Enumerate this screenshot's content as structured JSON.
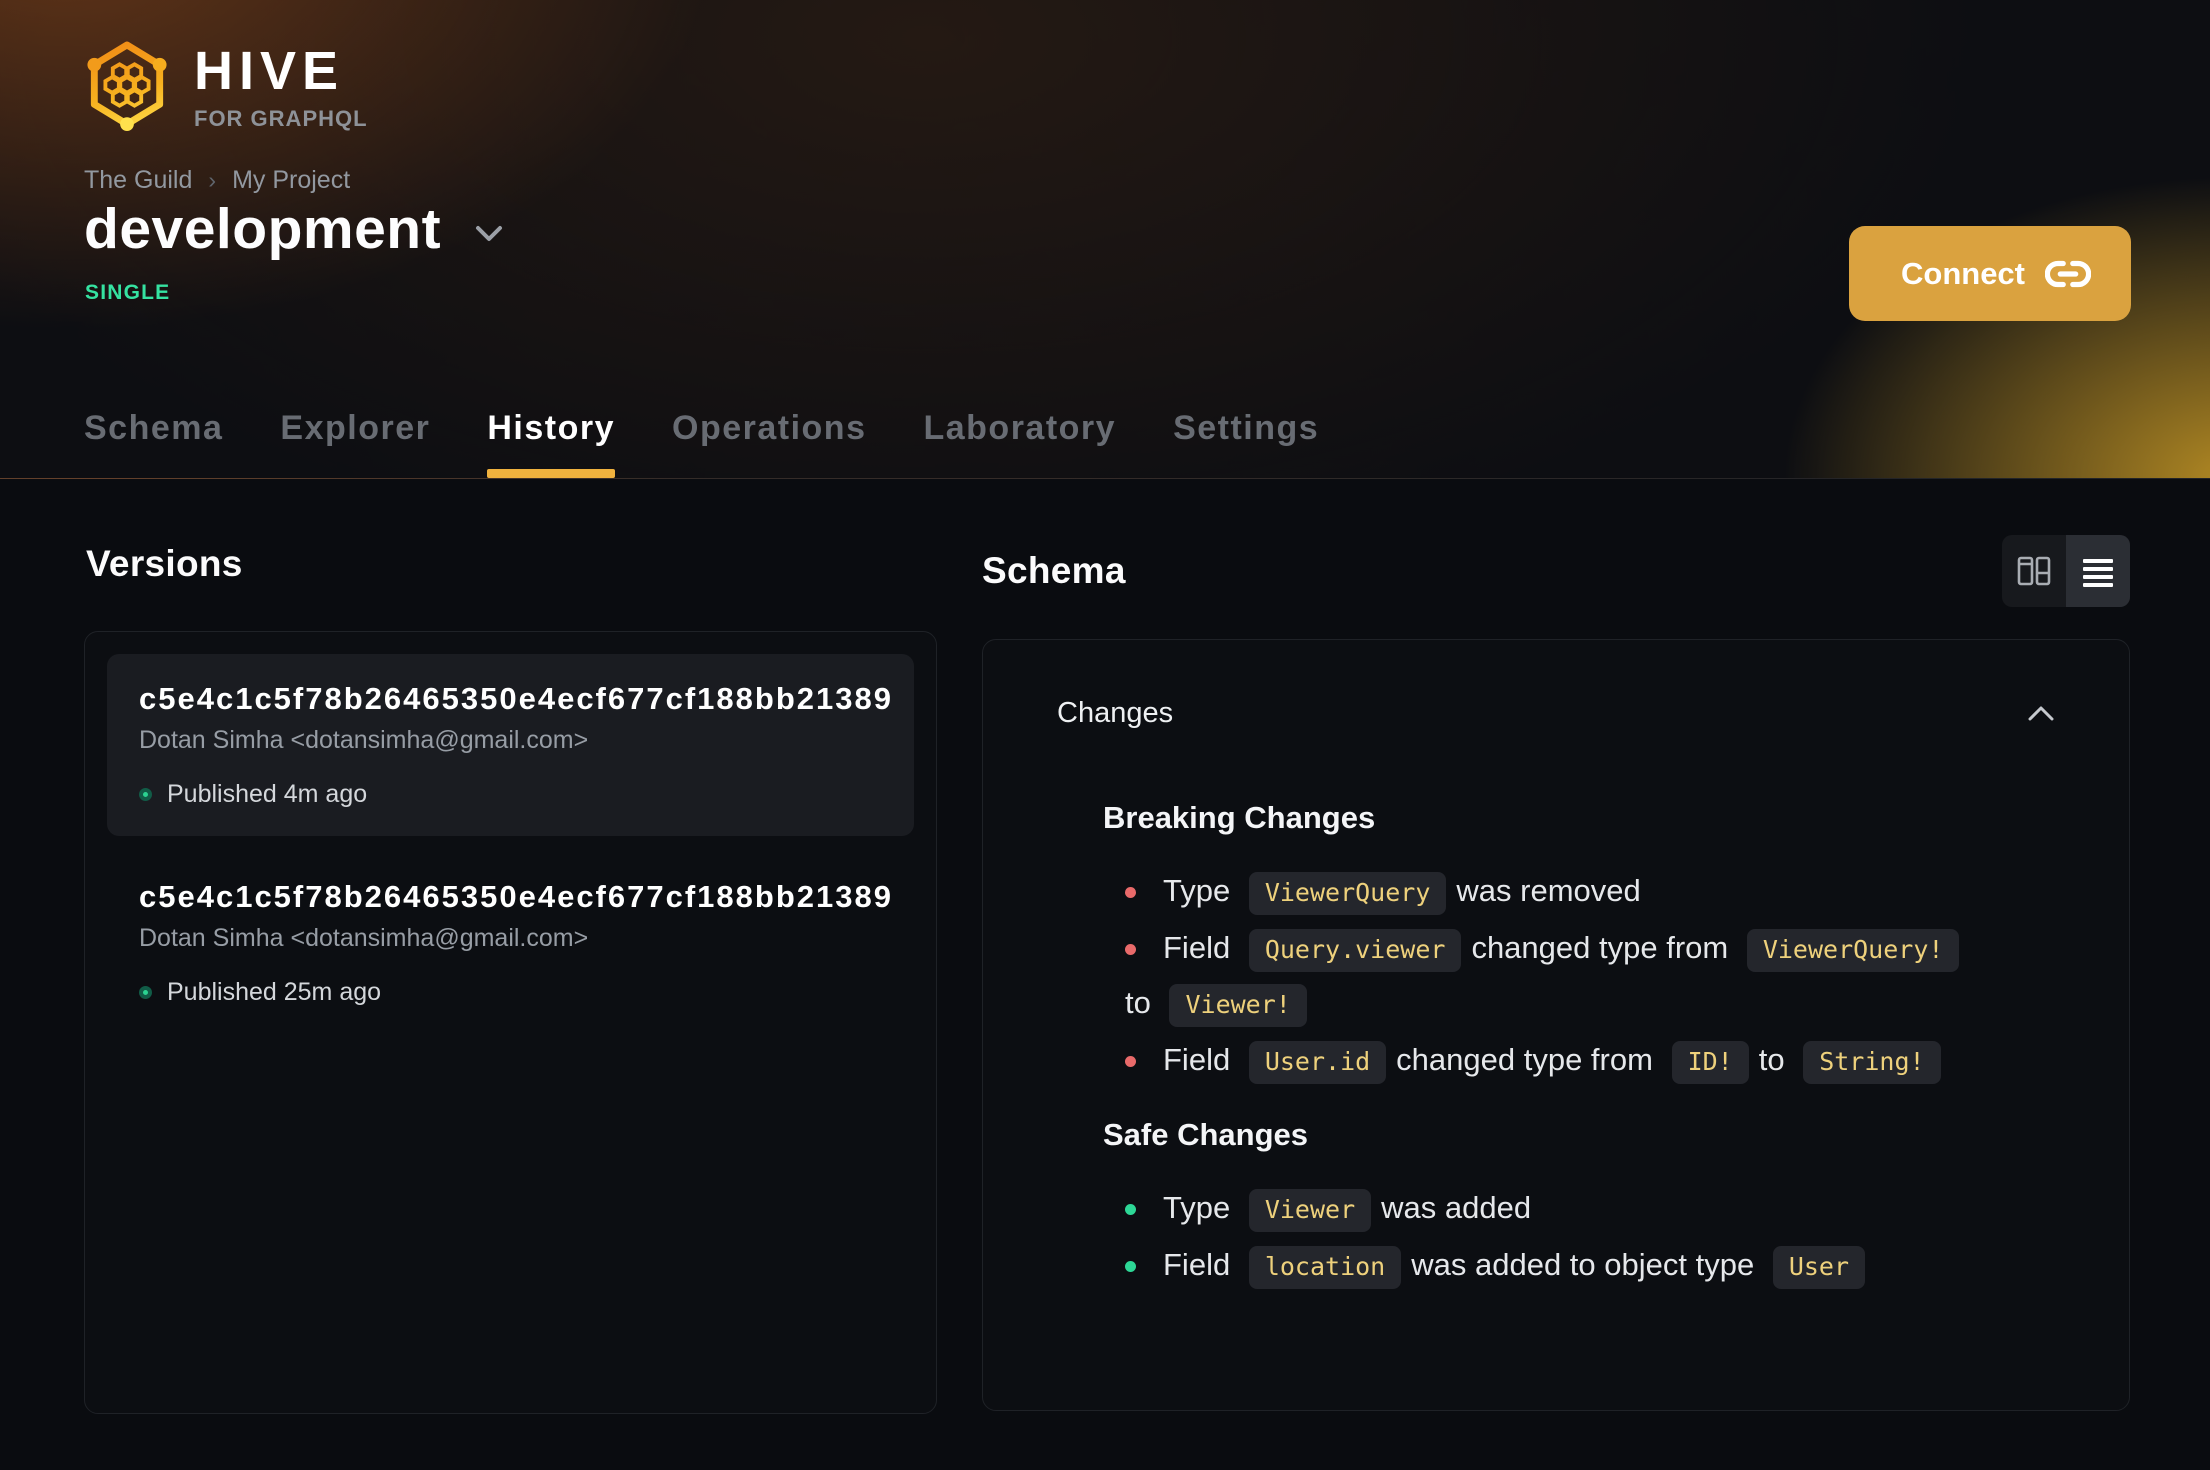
{
  "brand": {
    "name": "HIVE",
    "tagline": "FOR GRAPHQL"
  },
  "breadcrumb": {
    "items": [
      "The Guild",
      "My Project"
    ],
    "separator": "›"
  },
  "target": {
    "name": "development",
    "badge": "SINGLE"
  },
  "connect": {
    "label": "Connect"
  },
  "tabs": {
    "items": [
      "Schema",
      "Explorer",
      "History",
      "Operations",
      "Laboratory",
      "Settings"
    ],
    "active": "History"
  },
  "versions": {
    "heading": "Versions",
    "items": [
      {
        "hash": "c5e4c1c5f78b26465350e4ecf677cf188bb21389",
        "author": "Dotan Simha <dotansimha@gmail.com>",
        "status": "Published 4m ago",
        "highlighted": true
      },
      {
        "hash": "c5e4c1c5f78b26465350e4ecf677cf188bb21389",
        "author": "Dotan Simha <dotansimha@gmail.com>",
        "status": "Published 25m ago",
        "highlighted": false
      }
    ]
  },
  "schema": {
    "heading": "Schema"
  },
  "changes": {
    "title": "Changes",
    "breaking": {
      "title": "Breaking Changes",
      "items": [
        {
          "segments": [
            {
              "t": "text",
              "v": "Type"
            },
            {
              "t": "code",
              "v": "ViewerQuery"
            },
            {
              "t": "text",
              "v": "was removed"
            }
          ]
        },
        {
          "segments": [
            {
              "t": "text",
              "v": "Field"
            },
            {
              "t": "code",
              "v": "Query.viewer"
            },
            {
              "t": "text",
              "v": "changed type from"
            },
            {
              "t": "code",
              "v": "ViewerQuery!"
            },
            {
              "t": "br"
            },
            {
              "t": "text",
              "v": "to"
            },
            {
              "t": "code",
              "v": "Viewer!"
            }
          ]
        },
        {
          "segments": [
            {
              "t": "text",
              "v": "Field"
            },
            {
              "t": "code",
              "v": "User.id"
            },
            {
              "t": "text",
              "v": "changed type from"
            },
            {
              "t": "code",
              "v": "ID!"
            },
            {
              "t": "text",
              "v": "to"
            },
            {
              "t": "code",
              "v": "String!"
            }
          ]
        }
      ]
    },
    "safe": {
      "title": "Safe Changes",
      "items": [
        {
          "segments": [
            {
              "t": "text",
              "v": "Type"
            },
            {
              "t": "code",
              "v": "Viewer"
            },
            {
              "t": "text",
              "v": "was added"
            }
          ]
        },
        {
          "segments": [
            {
              "t": "text",
              "v": "Field"
            },
            {
              "t": "code",
              "v": "location"
            },
            {
              "t": "text",
              "v": "was added to object type"
            },
            {
              "t": "code",
              "v": "User"
            }
          ]
        }
      ]
    }
  },
  "icons": {
    "logo": "hive-logo-icon",
    "connect": "link-icon",
    "target_dropdown": "chevron-down-icon",
    "changes_collapse": "chevron-up-icon",
    "view_split": "columns-layout-icon",
    "view_list": "list-rows-icon",
    "published": "status-dot-icon"
  },
  "colors": {
    "accent_underline": "#f0b23e",
    "connect_button": "#daa23f",
    "badge_green": "#35e2a1",
    "published_dot": "#2bd291",
    "breaking_bullet": "#e96a6a",
    "safe_bullet": "#2dd796",
    "code_text": "#eed17c"
  }
}
